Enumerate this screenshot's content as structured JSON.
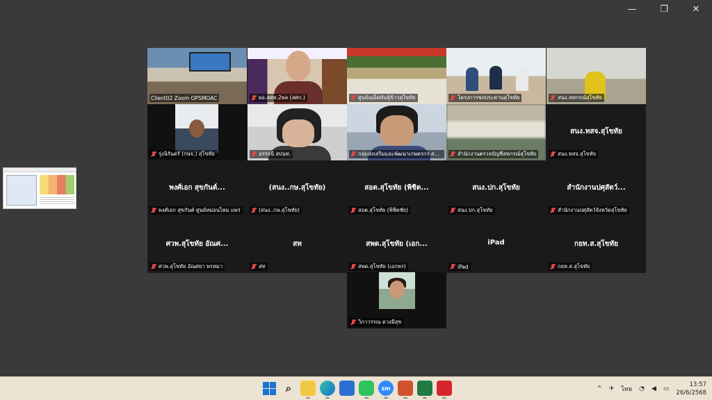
{
  "window": {
    "minimize_icon": "minimize-icon",
    "maximize_icon": "restore-icon",
    "close_icon": "close-icon",
    "minimize_glyph": "—",
    "restore_glyph": "❐",
    "close_glyph": "✕"
  },
  "participants": [
    {
      "label": "Client02 Zoom OPSMOAC",
      "video": true,
      "muted": false
    },
    {
      "label": "ผอ.สศท.2พล (สศก.)",
      "video": true,
      "muted": true
    },
    {
      "label": "ศูนย์เมล็ดพันธุ์ข้าวสุโขทัย",
      "video": true,
      "muted": true
    },
    {
      "label": "โครงการชลประทานสุโขทัย",
      "video": true,
      "muted": true,
      "active": true
    },
    {
      "label": "สนง.สหกรณ์สุโขทัย",
      "video": true,
      "muted": true
    },
    {
      "label": "รุ่งนิรันดร์ (กษจ.) สุโขทัย",
      "video": true,
      "muted": true
    },
    {
      "label": "อรรจนี สปนท.",
      "video": true,
      "muted": true
    },
    {
      "label": "กลุ่มส่งเสริมและพัฒนาเกษตรกร สนง.ก...",
      "video": true,
      "muted": true
    },
    {
      "label": "สำนักงานตรวจบัญชีสหกรณ์สุโขทัย",
      "video": true,
      "muted": true
    },
    {
      "label": "สนง.ทสจ.สุโขทัย",
      "big": "สนง.ทสจ.สุโขทัย",
      "video": false,
      "muted": true
    },
    {
      "label": "พงศ์เอก สุขกันต์  ศูนย์หม่อนไหม แพร่",
      "big": "พงศ์เอก สุขกันต์...",
      "video": false,
      "muted": true
    },
    {
      "label": "(สนง..กษ.สุโขทัย)",
      "big": "(สนง..กษ.สุโขทัย)",
      "video": false,
      "muted": true
    },
    {
      "label": "สอต.สุโขทัย (พิชิตชัย)",
      "big": "สอต.สุโขทัย (พิชิต...",
      "video": false,
      "muted": true
    },
    {
      "label": "สนง.ปก.สุโขทัย",
      "big": "สนง.ปก.สุโขทัย",
      "video": false,
      "muted": true
    },
    {
      "label": "สำนักงานปศุสัตว์จังหวัดสุโขทัย",
      "big": "สำนักงานปศุสัตว์...",
      "video": false,
      "muted": true
    },
    {
      "label": "ศวพ.สุโขทัย อัณศยา พรหมา",
      "big": "ศวพ.สุโขทัย อัณศ...",
      "video": false,
      "muted": true
    },
    {
      "label": "สท",
      "big": "สท",
      "video": false,
      "muted": true
    },
    {
      "label": "สพด.สุโขทัย (เอกพร)",
      "big": "สพด.สุโขทัย (เอก...",
      "video": false,
      "muted": true
    },
    {
      "label": "iPad",
      "big": "iPad",
      "video": false,
      "muted": true
    },
    {
      "label": "กยท.ส.สุโขทัย",
      "big": "กยท.ส.สุโขทัย",
      "video": false,
      "muted": true
    },
    {
      "label": "วิภาวรรณ ดวงมีสุข",
      "video": true,
      "muted": true
    }
  ],
  "taskbar": {
    "apps": [
      "start-icon",
      "search-icon",
      "file-explorer-icon",
      "edge-icon",
      "store-icon",
      "line-icon",
      "zoom-icon",
      "powerpoint-icon",
      "excel-icon",
      "acrobat-icon"
    ],
    "zoom_text": "zm",
    "search_glyph": "⌕",
    "chevron_glyph": "^",
    "lang": "ไทย",
    "time": "13:57",
    "date": "26/6/2568"
  }
}
